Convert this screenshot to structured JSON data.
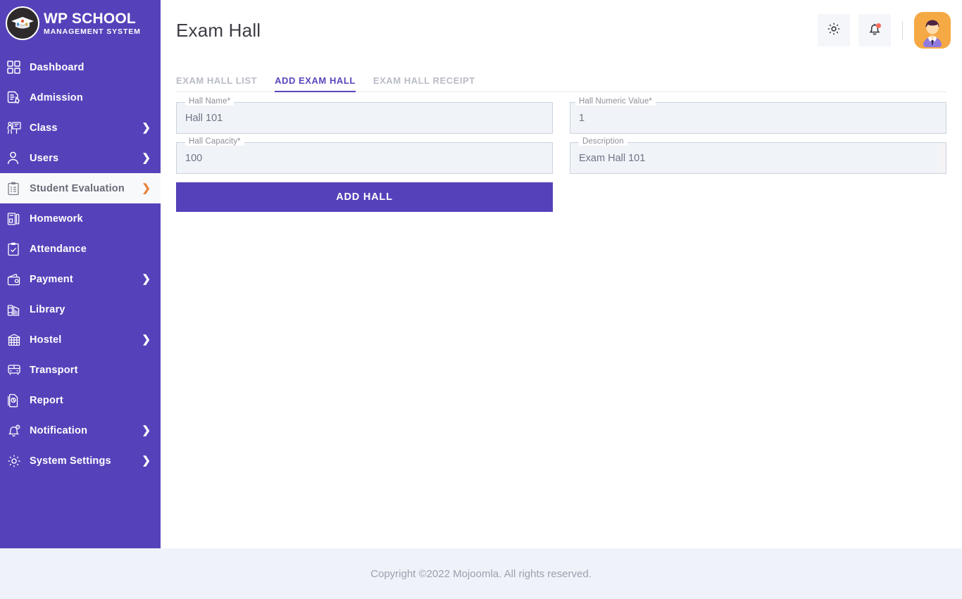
{
  "brand": {
    "title": "WP SCHOOL",
    "subtitle": "MANAGEMENT SYSTEM",
    "logo_icon": "graduation-cap-logo"
  },
  "sidebar": {
    "background_color": "#5542ba",
    "active_background_color": "#f8f9fb",
    "active_chevron_color": "#e8843c",
    "items": [
      {
        "label": "Dashboard",
        "icon": "grid-dashboard-icon",
        "has_chevron": false,
        "active": false
      },
      {
        "label": "Admission",
        "icon": "document-pencil-icon",
        "has_chevron": false,
        "active": false
      },
      {
        "label": "Class",
        "icon": "teacher-board-icon",
        "has_chevron": true,
        "active": false
      },
      {
        "label": "Users",
        "icon": "user-icon",
        "has_chevron": true,
        "active": false
      },
      {
        "label": "Student Evaluation",
        "icon": "clipboard-list-icon",
        "has_chevron": true,
        "active": true
      },
      {
        "label": "Homework",
        "icon": "book-stack-icon",
        "has_chevron": false,
        "active": false
      },
      {
        "label": "Attendance",
        "icon": "clipboard-check-icon",
        "has_chevron": false,
        "active": false
      },
      {
        "label": "Payment",
        "icon": "wallet-icon",
        "has_chevron": true,
        "active": false
      },
      {
        "label": "Library",
        "icon": "library-books-icon",
        "has_chevron": false,
        "active": false
      },
      {
        "label": "Hostel",
        "icon": "hostel-building-icon",
        "has_chevron": true,
        "active": false
      },
      {
        "label": "Transport",
        "icon": "bus-icon",
        "has_chevron": false,
        "active": false
      },
      {
        "label": "Report",
        "icon": "report-file-icon",
        "has_chevron": false,
        "active": false
      },
      {
        "label": "Notification",
        "icon": "bell-icon",
        "has_chevron": true,
        "active": false
      },
      {
        "label": "System Settings",
        "icon": "gear-icon",
        "has_chevron": true,
        "active": false
      }
    ],
    "chevron_glyph": "❯"
  },
  "topbar": {
    "page_title": "Exam Hall",
    "settings_icon": "gear-icon",
    "notifications_icon": "bell-icon",
    "notification_badge": true,
    "avatar_icon": "user-avatar"
  },
  "tabs": [
    {
      "label": "EXAM HALL LIST",
      "active": false
    },
    {
      "label": "ADD EXAM HALL",
      "active": true
    },
    {
      "label": "EXAM HALL RECEIPT",
      "active": false
    }
  ],
  "form": {
    "fields": [
      {
        "label": "Hall Name*",
        "value": "Hall 101",
        "placeholder": "Hall Name",
        "column": "left",
        "type": "text"
      },
      {
        "label": "Hall Numeric Value*",
        "value": "1",
        "placeholder": "Hall Numeric Value",
        "column": "right",
        "type": "text"
      },
      {
        "label": "Hall Capacity*",
        "value": "100",
        "placeholder": "Hall Capacity",
        "column": "left",
        "type": "text"
      },
      {
        "label": "Description",
        "value": "Exam Hall 101",
        "placeholder": "Description",
        "column": "right",
        "type": "textarea"
      }
    ],
    "submit_label": "ADD HALL"
  },
  "footer": {
    "text": "Copyright ©2022 Mojoomla. All rights reserved."
  },
  "colors": {
    "primary": "#5542ba",
    "tab_active": "#5b45bd",
    "field_bg": "#f0f3f8",
    "footer_bg": "#eff3f9",
    "accent_orange": "#e8843c"
  }
}
